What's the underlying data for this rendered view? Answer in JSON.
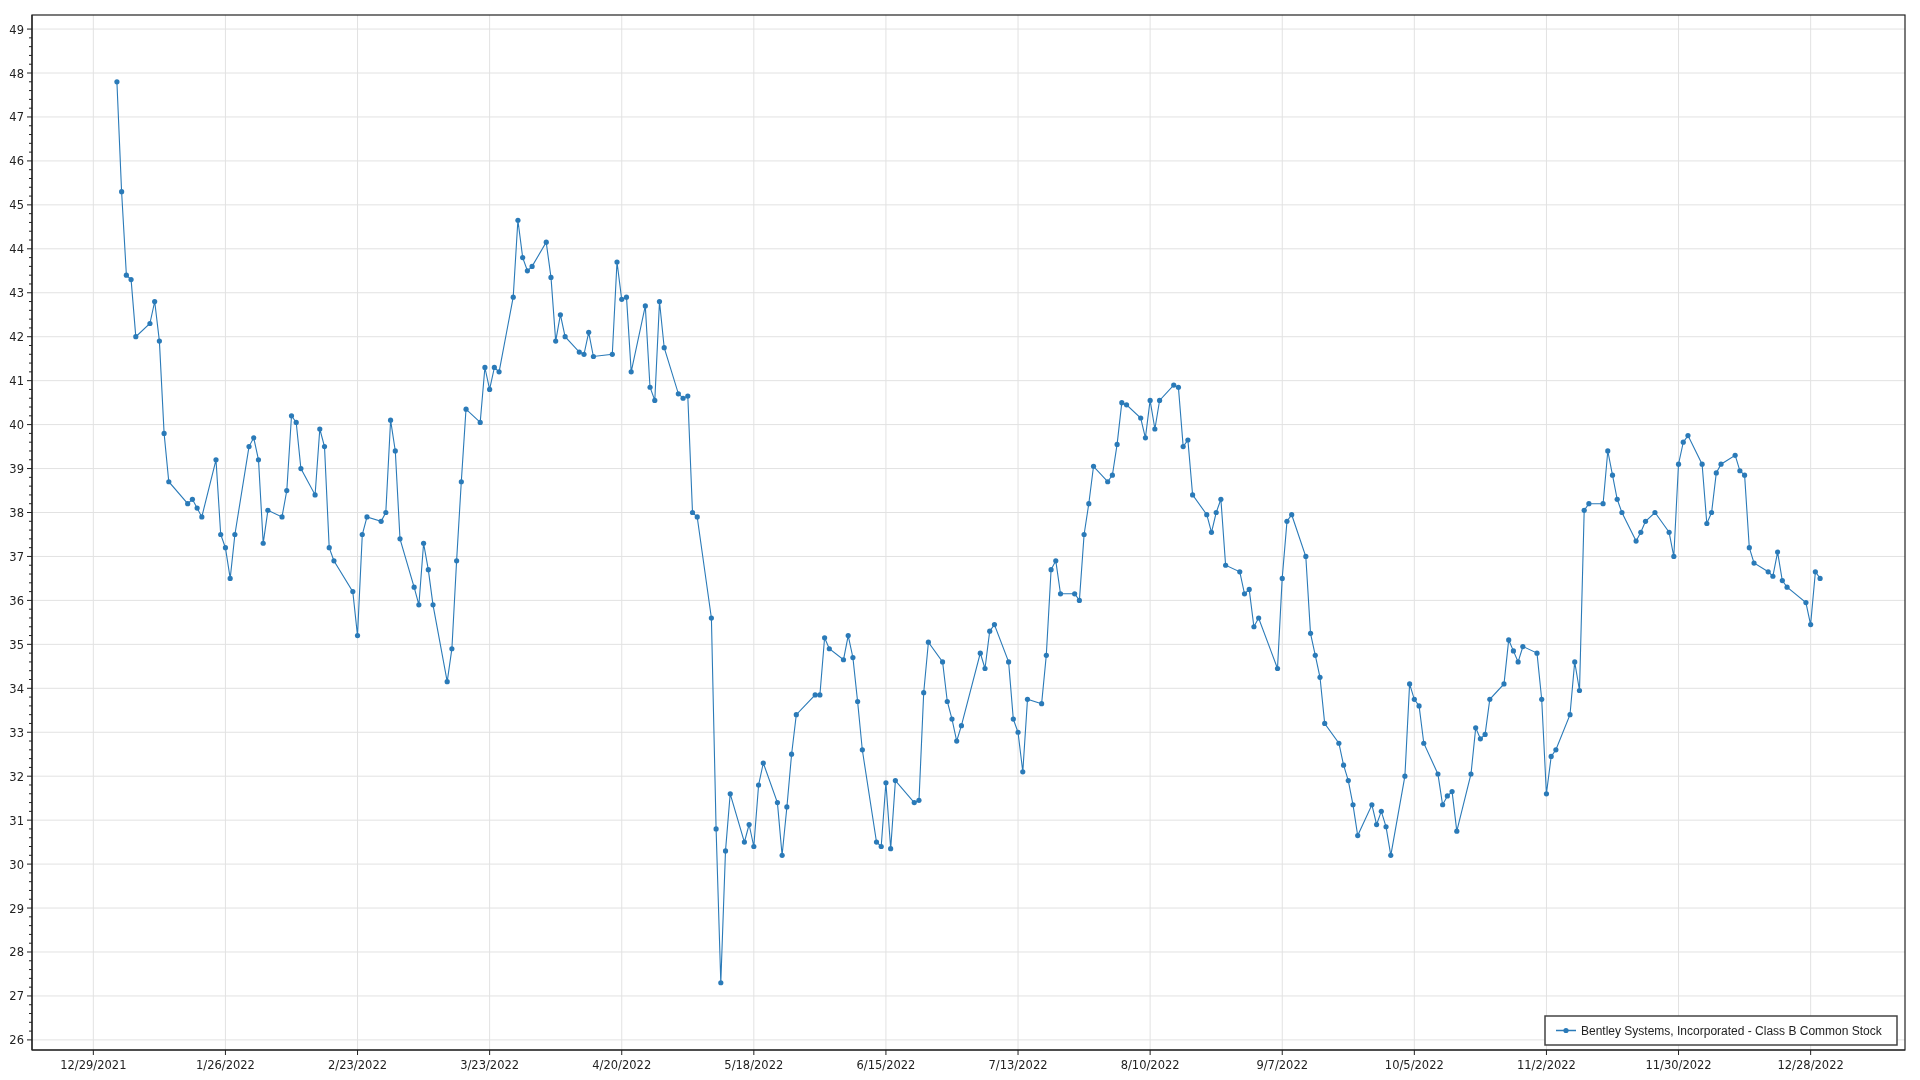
{
  "chart_data": {
    "type": "line",
    "grid": true,
    "x": [
      "2022-01-03",
      "2022-01-04",
      "2022-01-05",
      "2022-01-06",
      "2022-01-07",
      "2022-01-10",
      "2022-01-11",
      "2022-01-12",
      "2022-01-13",
      "2022-01-14",
      "2022-01-18",
      "2022-01-19",
      "2022-01-20",
      "2022-01-21",
      "2022-01-24",
      "2022-01-25",
      "2022-01-26",
      "2022-01-27",
      "2022-01-28",
      "2022-01-31",
      "2022-02-01",
      "2022-02-02",
      "2022-02-03",
      "2022-02-04",
      "2022-02-07",
      "2022-02-08",
      "2022-02-09",
      "2022-02-10",
      "2022-02-11",
      "2022-02-14",
      "2022-02-15",
      "2022-02-16",
      "2022-02-17",
      "2022-02-18",
      "2022-02-22",
      "2022-02-23",
      "2022-02-24",
      "2022-02-25",
      "2022-02-28",
      "2022-03-01",
      "2022-03-02",
      "2022-03-03",
      "2022-03-04",
      "2022-03-07",
      "2022-03-08",
      "2022-03-09",
      "2022-03-10",
      "2022-03-11",
      "2022-03-14",
      "2022-03-15",
      "2022-03-16",
      "2022-03-17",
      "2022-03-18",
      "2022-03-21",
      "2022-03-22",
      "2022-03-23",
      "2022-03-24",
      "2022-03-25",
      "2022-03-28",
      "2022-03-29",
      "2022-03-30",
      "2022-03-31",
      "2022-04-01",
      "2022-04-04",
      "2022-04-05",
      "2022-04-06",
      "2022-04-07",
      "2022-04-08",
      "2022-04-11",
      "2022-04-12",
      "2022-04-13",
      "2022-04-14",
      "2022-04-18",
      "2022-04-19",
      "2022-04-20",
      "2022-04-21",
      "2022-04-22",
      "2022-04-25",
      "2022-04-26",
      "2022-04-27",
      "2022-04-28",
      "2022-04-29",
      "2022-05-02",
      "2022-05-03",
      "2022-05-04",
      "2022-05-05",
      "2022-05-06",
      "2022-05-09",
      "2022-05-10",
      "2022-05-11",
      "2022-05-12",
      "2022-05-13",
      "2022-05-16",
      "2022-05-17",
      "2022-05-18",
      "2022-05-19",
      "2022-05-20",
      "2022-05-23",
      "2022-05-24",
      "2022-05-25",
      "2022-05-26",
      "2022-05-27",
      "2022-05-31",
      "2022-06-01",
      "2022-06-02",
      "2022-06-03",
      "2022-06-06",
      "2022-06-07",
      "2022-06-08",
      "2022-06-09",
      "2022-06-10",
      "2022-06-13",
      "2022-06-14",
      "2022-06-15",
      "2022-06-16",
      "2022-06-17",
      "2022-06-21",
      "2022-06-22",
      "2022-06-23",
      "2022-06-24",
      "2022-06-27",
      "2022-06-28",
      "2022-06-29",
      "2022-06-30",
      "2022-07-01",
      "2022-07-05",
      "2022-07-06",
      "2022-07-07",
      "2022-07-08",
      "2022-07-11",
      "2022-07-12",
      "2022-07-13",
      "2022-07-14",
      "2022-07-15",
      "2022-07-18",
      "2022-07-19",
      "2022-07-20",
      "2022-07-21",
      "2022-07-22",
      "2022-07-25",
      "2022-07-26",
      "2022-07-27",
      "2022-07-28",
      "2022-07-29",
      "2022-08-01",
      "2022-08-02",
      "2022-08-03",
      "2022-08-04",
      "2022-08-05",
      "2022-08-08",
      "2022-08-09",
      "2022-08-10",
      "2022-08-11",
      "2022-08-12",
      "2022-08-15",
      "2022-08-16",
      "2022-08-17",
      "2022-08-18",
      "2022-08-19",
      "2022-08-22",
      "2022-08-23",
      "2022-08-24",
      "2022-08-25",
      "2022-08-26",
      "2022-08-29",
      "2022-08-30",
      "2022-08-31",
      "2022-09-01",
      "2022-09-02",
      "2022-09-06",
      "2022-09-07",
      "2022-09-08",
      "2022-09-09",
      "2022-09-12",
      "2022-09-13",
      "2022-09-14",
      "2022-09-15",
      "2022-09-16",
      "2022-09-19",
      "2022-09-20",
      "2022-09-21",
      "2022-09-22",
      "2022-09-23",
      "2022-09-26",
      "2022-09-27",
      "2022-09-28",
      "2022-09-29",
      "2022-09-30",
      "2022-10-03",
      "2022-10-04",
      "2022-10-05",
      "2022-10-06",
      "2022-10-07",
      "2022-10-10",
      "2022-10-11",
      "2022-10-12",
      "2022-10-13",
      "2022-10-14",
      "2022-10-17",
      "2022-10-18",
      "2022-10-19",
      "2022-10-20",
      "2022-10-21",
      "2022-10-24",
      "2022-10-25",
      "2022-10-26",
      "2022-10-27",
      "2022-10-28",
      "2022-10-31",
      "2022-11-01",
      "2022-11-02",
      "2022-11-03",
      "2022-11-04",
      "2022-11-07",
      "2022-11-08",
      "2022-11-09",
      "2022-11-10",
      "2022-11-11",
      "2022-11-14",
      "2022-11-15",
      "2022-11-16",
      "2022-11-17",
      "2022-11-18",
      "2022-11-21",
      "2022-11-22",
      "2022-11-23",
      "2022-11-25",
      "2022-11-28",
      "2022-11-29",
      "2022-11-30",
      "2022-12-01",
      "2022-12-02",
      "2022-12-05",
      "2022-12-06",
      "2022-12-07",
      "2022-12-08",
      "2022-12-09",
      "2022-12-12",
      "2022-12-13",
      "2022-12-14",
      "2022-12-15",
      "2022-12-16",
      "2022-12-19",
      "2022-12-20",
      "2022-12-21",
      "2022-12-22",
      "2022-12-23",
      "2022-12-27",
      "2022-12-28",
      "2022-12-29",
      "2022-12-30"
    ],
    "series": [
      {
        "name": "Bentley Systems, Incorporated - Class B Common Stock",
        "color": "#2a7ab8",
        "values": [
          47.8,
          45.3,
          43.4,
          43.3,
          42.0,
          42.3,
          42.8,
          41.9,
          39.8,
          38.7,
          38.2,
          38.3,
          38.1,
          37.9,
          39.2,
          37.5,
          37.2,
          36.5,
          37.5,
          39.5,
          39.7,
          39.2,
          37.3,
          38.05,
          37.9,
          38.5,
          40.2,
          40.05,
          39.0,
          38.4,
          39.9,
          39.5,
          37.2,
          36.9,
          36.2,
          35.2,
          37.5,
          37.9,
          37.8,
          38.0,
          40.1,
          39.4,
          37.4,
          36.3,
          35.9,
          37.3,
          36.7,
          35.9,
          34.15,
          34.9,
          36.9,
          38.7,
          40.35,
          40.05,
          41.3,
          40.8,
          41.3,
          41.2,
          42.9,
          44.65,
          43.8,
          43.5,
          43.6,
          44.15,
          43.35,
          41.9,
          42.5,
          42.0,
          41.65,
          41.6,
          42.1,
          41.55,
          41.6,
          43.7,
          42.85,
          42.9,
          41.2,
          42.7,
          40.85,
          40.55,
          42.8,
          41.75,
          40.7,
          40.6,
          40.65,
          38.0,
          37.9,
          35.6,
          30.8,
          27.3,
          30.3,
          31.6,
          30.5,
          30.9,
          30.4,
          31.8,
          32.3,
          31.4,
          30.2,
          31.3,
          32.5,
          33.4,
          33.85,
          33.85,
          35.15,
          34.9,
          34.65,
          35.2,
          34.7,
          33.7,
          32.6,
          30.5,
          30.4,
          31.85,
          30.35,
          31.9,
          31.4,
          31.45,
          33.9,
          35.05,
          34.6,
          33.7,
          33.3,
          32.8,
          33.15,
          34.8,
          34.45,
          35.3,
          35.45,
          34.6,
          33.3,
          33.0,
          32.1,
          33.75,
          33.65,
          34.75,
          36.7,
          36.9,
          36.15,
          36.15,
          36.0,
          37.5,
          38.2,
          39.05,
          38.7,
          38.85,
          39.55,
          40.5,
          40.45,
          40.15,
          39.7,
          40.55,
          39.9,
          40.55,
          40.9,
          40.85,
          39.5,
          39.65,
          38.4,
          37.95,
          37.55,
          38.0,
          38.3,
          36.8,
          36.65,
          36.15,
          36.25,
          35.4,
          35.6,
          34.45,
          36.5,
          37.8,
          37.95,
          37.0,
          35.25,
          34.75,
          34.25,
          33.2,
          32.75,
          32.25,
          31.9,
          31.35,
          30.65,
          31.35,
          30.9,
          31.2,
          30.85,
          30.2,
          32.0,
          34.1,
          33.75,
          33.6,
          32.75,
          32.05,
          31.35,
          31.55,
          31.65,
          30.75,
          32.05,
          33.1,
          32.85,
          32.95,
          33.75,
          34.1,
          35.1,
          34.85,
          34.6,
          34.95,
          34.8,
          33.75,
          31.6,
          32.45,
          32.6,
          33.4,
          34.6,
          33.95,
          38.05,
          38.2,
          38.2,
          39.4,
          38.85,
          38.3,
          38.0,
          37.35,
          37.55,
          37.8,
          38.0,
          37.55,
          37.0,
          39.1,
          39.6,
          39.75,
          39.1,
          37.75,
          38.0,
          38.9,
          39.1,
          39.3,
          38.95,
          38.85,
          37.2,
          36.85,
          36.65,
          36.55,
          37.1,
          36.45,
          36.3,
          35.95,
          35.45,
          36.65,
          36.5
        ]
      }
    ],
    "xlim": [
      "2021-12-16",
      "2023-01-17"
    ],
    "ylim": [
      25.77,
      49.32
    ],
    "xticks": [
      {
        "value": "2021-12-29",
        "label": "12/29/2021"
      },
      {
        "value": "2022-01-26",
        "label": "1/26/2022"
      },
      {
        "value": "2022-02-23",
        "label": "2/23/2022"
      },
      {
        "value": "2022-03-23",
        "label": "3/23/2022"
      },
      {
        "value": "2022-04-20",
        "label": "4/20/2022"
      },
      {
        "value": "2022-05-18",
        "label": "5/18/2022"
      },
      {
        "value": "2022-06-15",
        "label": "6/15/2022"
      },
      {
        "value": "2022-07-13",
        "label": "7/13/2022"
      },
      {
        "value": "2022-08-10",
        "label": "8/10/2022"
      },
      {
        "value": "2022-09-07",
        "label": "9/7/2022"
      },
      {
        "value": "2022-10-05",
        "label": "10/5/2022"
      },
      {
        "value": "2022-11-02",
        "label": "11/2/2022"
      },
      {
        "value": "2022-11-30",
        "label": "11/30/2022"
      },
      {
        "value": "2022-12-28",
        "label": "12/28/2022"
      }
    ],
    "yticks": [
      26,
      27,
      28,
      29,
      30,
      31,
      32,
      33,
      34,
      35,
      36,
      37,
      38,
      39,
      40,
      41,
      42,
      43,
      44,
      45,
      46,
      47,
      48,
      49
    ]
  }
}
